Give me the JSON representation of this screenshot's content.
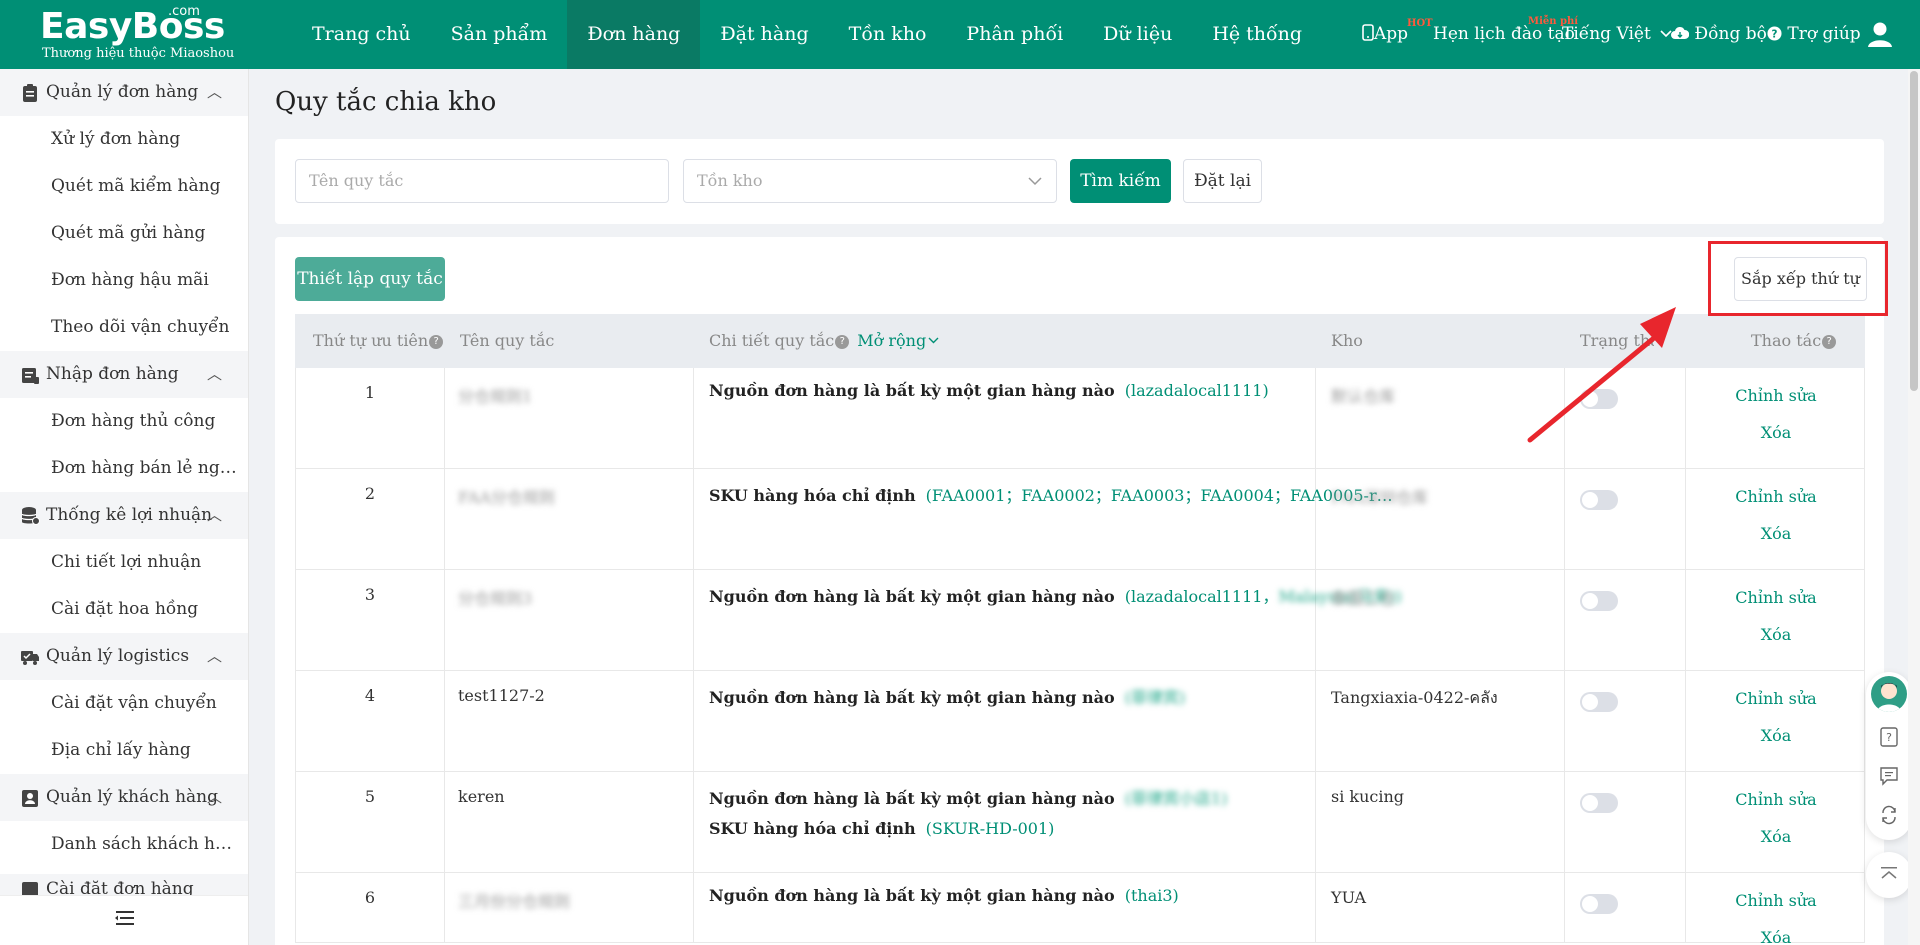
{
  "header": {
    "logo_main": "EasyBoss",
    "logo_com": ".com",
    "logo_sub": "Thương hiệu thuộc Miaoshou",
    "nav": [
      "Trang chủ",
      "Sản phẩm",
      "Đơn hàng",
      "Đặt hàng",
      "Tồn kho",
      "Phân phối",
      "Dữ liệu",
      "Hệ thống"
    ],
    "active_nav": "Đơn hàng",
    "app_label": "App",
    "app_badge": "HOT",
    "training_label": "Hẹn lịch đào tạo",
    "training_badge": "Miễn phí",
    "language": "Tiếng Việt",
    "sync_label": "Đồng bộ",
    "help_label": "Trợ giúp"
  },
  "sidebar": {
    "groups": [
      {
        "label": "Quản lý đơn hàng",
        "icon": "clipboard-icon",
        "items": [
          "Xử lý đơn hàng",
          "Quét mã kiểm hàng",
          "Quét mã gửi hàng",
          "Đơn hàng hậu mãi",
          "Theo dõi vận chuyển"
        ]
      },
      {
        "label": "Nhập đơn hàng",
        "icon": "import-icon",
        "items": [
          "Đơn hàng thủ công",
          "Đơn hàng bán lẻ ngoại tuyến"
        ]
      },
      {
        "label": "Thống kê lợi nhuận",
        "icon": "database-icon",
        "items": [
          "Chi tiết lợi nhuận",
          "Cài đặt hoa hồng"
        ]
      },
      {
        "label": "Quản lý logistics",
        "icon": "truck-icon",
        "items": [
          "Cài đặt vận chuyển",
          "Địa chỉ lấy hàng"
        ]
      },
      {
        "label": "Quản lý khách hàng",
        "icon": "contact-icon",
        "items": [
          "Danh sách khách hàng"
        ]
      },
      {
        "label": "Cài đặt đơn hàng",
        "icon": "settings-icon",
        "items": []
      }
    ]
  },
  "page": {
    "title": "Quy tắc chia kho",
    "filter": {
      "rule_name_placeholder": "Tên quy tắc",
      "warehouse_placeholder": "Tồn kho",
      "search_label": "Tìm kiếm",
      "reset_label": "Đặt lại"
    },
    "setup_label": "Thiết lập quy tắc",
    "sort_label": "Sắp xếp thứ tự",
    "columns": {
      "priority": "Thứ tự ưu tiên",
      "name": "Tên quy tắc",
      "detail": "Chi tiết quy tắc",
      "expand": "Mở rộng",
      "warehouse": "Kho",
      "status": "Trạng thái",
      "actions": "Thao tác"
    },
    "edit_label": "Chỉnh sửa",
    "delete_label": "Xóa",
    "rows": [
      {
        "priority": "1",
        "name": "分仓规则1",
        "conditions": [
          {
            "label": "Nguồn đơn hàng là bất kỳ một gian hàng nào",
            "value": "(lazadalocal1111)",
            "blurred_value": ""
          }
        ],
        "warehouse": "默认仓库",
        "name_blurred": true,
        "warehouse_blurred": true
      },
      {
        "priority": "2",
        "name": "FAA分仓规则",
        "conditions": [
          {
            "label": "SKU hàng hóa chỉ định",
            "value": "(FAA0001；FAA0002；FAA0003；FAA0004；FAA0005-r…",
            "blurred_value": ""
          }
        ],
        "warehouse": "FAA深圳仓库",
        "name_blurred": true,
        "warehouse_blurred": true
      },
      {
        "priority": "3",
        "name": "分仓规则3",
        "conditions": [
          {
            "label": "Nguồn đơn hàng là bất kỳ một gian hàng nào",
            "value": "(lazadalocal1111，",
            "blurred_value": "Malaysia(马来))"
          }
        ],
        "warehouse": "泰国二仓",
        "name_blurred": true,
        "warehouse_blurred": true
      },
      {
        "priority": "4",
        "name": "test1127-2",
        "conditions": [
          {
            "label": "Nguồn đơn hàng là bất kỳ một gian hàng nào",
            "value": "",
            "blurred_value": "(菲律宾)"
          }
        ],
        "warehouse": "Tangxiaxia-0422-คลัง",
        "name_blurred": false,
        "warehouse_blurred": false
      },
      {
        "priority": "5",
        "name": "keren",
        "conditions": [
          {
            "label": "Nguồn đơn hàng là bất kỳ một gian hàng nào",
            "value": "",
            "blurred_value": "(菲律宾小店1)"
          },
          {
            "label": "SKU hàng hóa chỉ định",
            "value": "(SKUR-HD-001)",
            "blurred_value": ""
          }
        ],
        "warehouse": "si kucing",
        "name_blurred": false,
        "warehouse_blurred": false
      },
      {
        "priority": "6",
        "name": "三月份分仓规则",
        "conditions": [
          {
            "label": "Nguồn đơn hàng là bất kỳ một gian hàng nào",
            "value": "(thai3)",
            "blurred_value": ""
          }
        ],
        "warehouse": "YUA",
        "name_blurred": true,
        "warehouse_blurred": false
      }
    ]
  },
  "colors": {
    "brand": "#008f75",
    "highlight": "#e8262d"
  }
}
